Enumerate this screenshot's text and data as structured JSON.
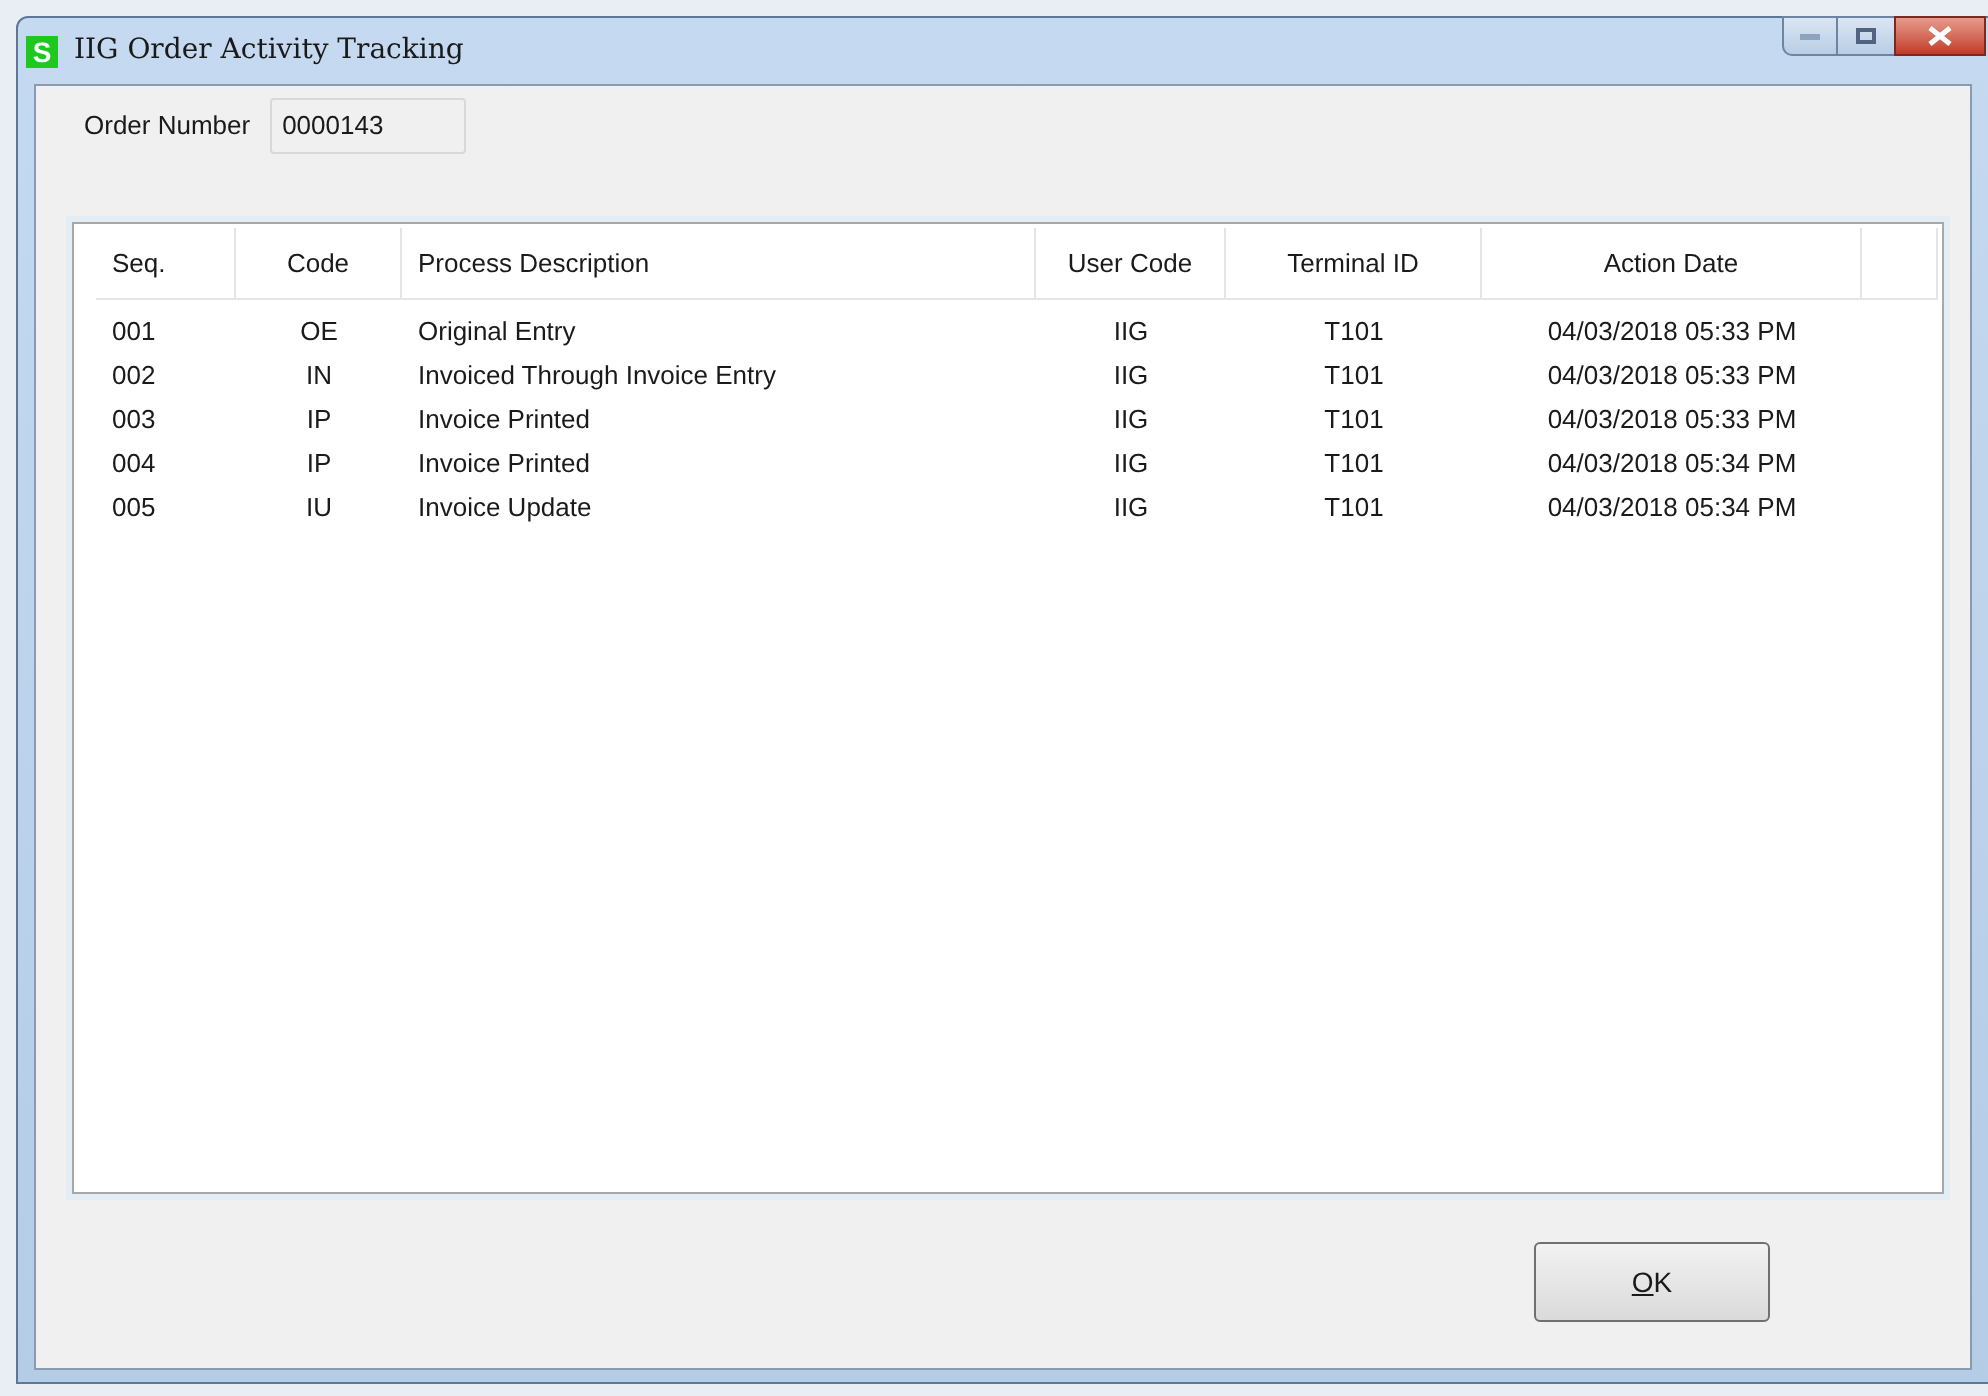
{
  "window": {
    "title": "IIG Order Activity Tracking",
    "app_icon": "S"
  },
  "order_number": {
    "label": "Order Number",
    "value": "0000143"
  },
  "table": {
    "columns": [
      "Seq.",
      "Code",
      "Process Description",
      "User Code",
      "Terminal ID",
      "Action Date"
    ],
    "rows": [
      [
        "001",
        "OE",
        "Original Entry",
        "IIG",
        "T101",
        "04/03/2018 05:33 PM"
      ],
      [
        "002",
        "IN",
        "Invoiced Through Invoice Entry",
        "IIG",
        "T101",
        "04/03/2018 05:33 PM"
      ],
      [
        "003",
        "IP",
        "Invoice Printed",
        "IIG",
        "T101",
        "04/03/2018 05:33 PM"
      ],
      [
        "004",
        "IP",
        "Invoice Printed",
        "IIG",
        "T101",
        "04/03/2018 05:34 PM"
      ],
      [
        "005",
        "IU",
        "Invoice Update",
        "IIG",
        "T101",
        "04/03/2018 05:34 PM"
      ]
    ]
  },
  "buttons": {
    "ok": "OK"
  }
}
